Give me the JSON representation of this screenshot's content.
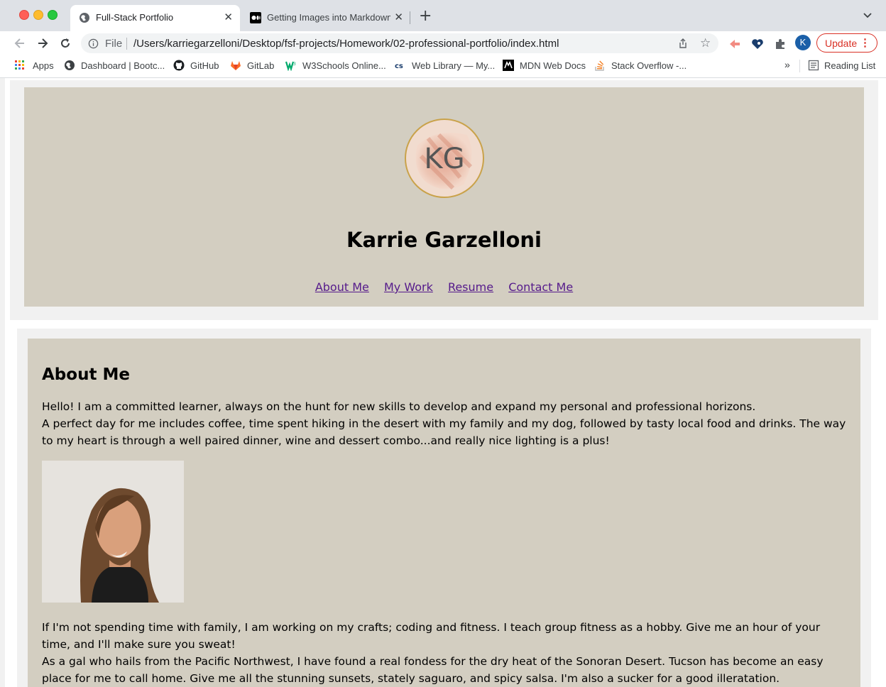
{
  "browser": {
    "tabs": [
      {
        "title": "Full-Stack Portfolio",
        "active": true
      },
      {
        "title": "Getting Images into Markdown",
        "active": false
      }
    ],
    "address": {
      "scheme_label": "File",
      "url": "/Users/karriegarzelloni/Desktop/fsf-projects/Homework/02-professional-portfolio/index.html"
    },
    "profile_initial": "K",
    "update_label": "Update",
    "bookmarks": [
      {
        "label": "Apps",
        "icon": "apps-grid-icon"
      },
      {
        "label": "Dashboard | Bootc...",
        "icon": "globe-icon"
      },
      {
        "label": "GitHub",
        "icon": "github-icon"
      },
      {
        "label": "GitLab",
        "icon": "gitlab-icon"
      },
      {
        "label": "W3Schools Online...",
        "icon": "w3schools-icon"
      },
      {
        "label": "Web Library — My...",
        "icon": "cs-icon"
      },
      {
        "label": "MDN Web Docs",
        "icon": "mdn-icon"
      },
      {
        "label": "Stack Overflow -...",
        "icon": "stackoverflow-icon"
      }
    ],
    "bookmarks_overflow": "»",
    "reading_list": "Reading List"
  },
  "page": {
    "logo_text": "KG",
    "name": "Karrie Garzelloni",
    "nav": [
      "About Me",
      "My Work",
      "Resume",
      "Contact Me"
    ],
    "about": {
      "heading": "About Me",
      "p1": "Hello! I am a committed learner, always on the hunt for new skills to develop and expand my personal and professional horizons.",
      "p2": "A perfect day for me includes coffee, time spent hiking in the desert with my family and my dog, followed by tasty local food and drinks. The way to my heart is through a well paired dinner, wine and dessert combo...and really nice lighting is a plus!",
      "p3": "If I'm not spending time with family, I am working on my crafts; coding and fitness. I teach group fitness as a hobby. Give me an hour of your time, and I'll make sure you sweat!",
      "p4": "As a gal who hails from the Pacific Northwest, I have found a real fondess for the dry heat of the Sonoran Desert. Tucson has become an easy place for me to call home. Give me all the stunning sunsets, stately saguaro, and spicy salsa. I'm also a sucker for a good illeratation."
    }
  },
  "colors": {
    "header_bg": "#d3cec1",
    "link": "#551a8b",
    "update_red": "#d93025"
  }
}
